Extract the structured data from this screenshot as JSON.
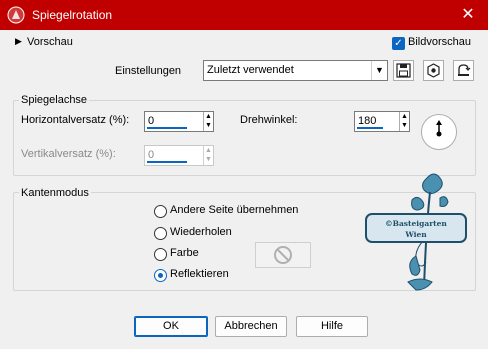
{
  "window": {
    "title": "Spiegelrotation",
    "close_glyph": "✕",
    "icon": "app-logo-icon",
    "title_bar_color": "#c00000"
  },
  "top": {
    "preview_label": "Vorschau",
    "preview_toggle_glyph": "▶",
    "image_preview_label": "Bildvorschau",
    "image_preview_checked": true,
    "settings_label": "Einstellungen",
    "settings_value": "Zuletzt verwendet",
    "toolbar_icons": [
      "save-icon",
      "preset-icon",
      "reset-icon"
    ]
  },
  "mirror_axis": {
    "title": "Spiegelachse",
    "horizontal_offset_label": "Horizontalversatz (%):",
    "horizontal_offset_value": "0",
    "rotation_angle_label": "Drehwinkel:",
    "rotation_angle_value": "180",
    "vertical_offset_label": "Vertikalversatz (%):",
    "vertical_offset_value": "0",
    "vertical_offset_enabled": false
  },
  "edge_mode": {
    "title": "Kantenmodus",
    "options": [
      {
        "label": "Andere Seite übernehmen",
        "selected": false
      },
      {
        "label": "Wiederholen",
        "selected": false
      },
      {
        "label": "Farbe",
        "selected": false
      },
      {
        "label": "Reflektieren",
        "selected": true
      }
    ]
  },
  "watermark": {
    "line1": "©Basteigarten",
    "line2": "Wien"
  },
  "buttons": {
    "ok": "OK",
    "cancel": "Abbrechen",
    "help": "Hilfe"
  },
  "colors": {
    "accent": "#0a66c2",
    "watermark": "#2b6a8a"
  }
}
